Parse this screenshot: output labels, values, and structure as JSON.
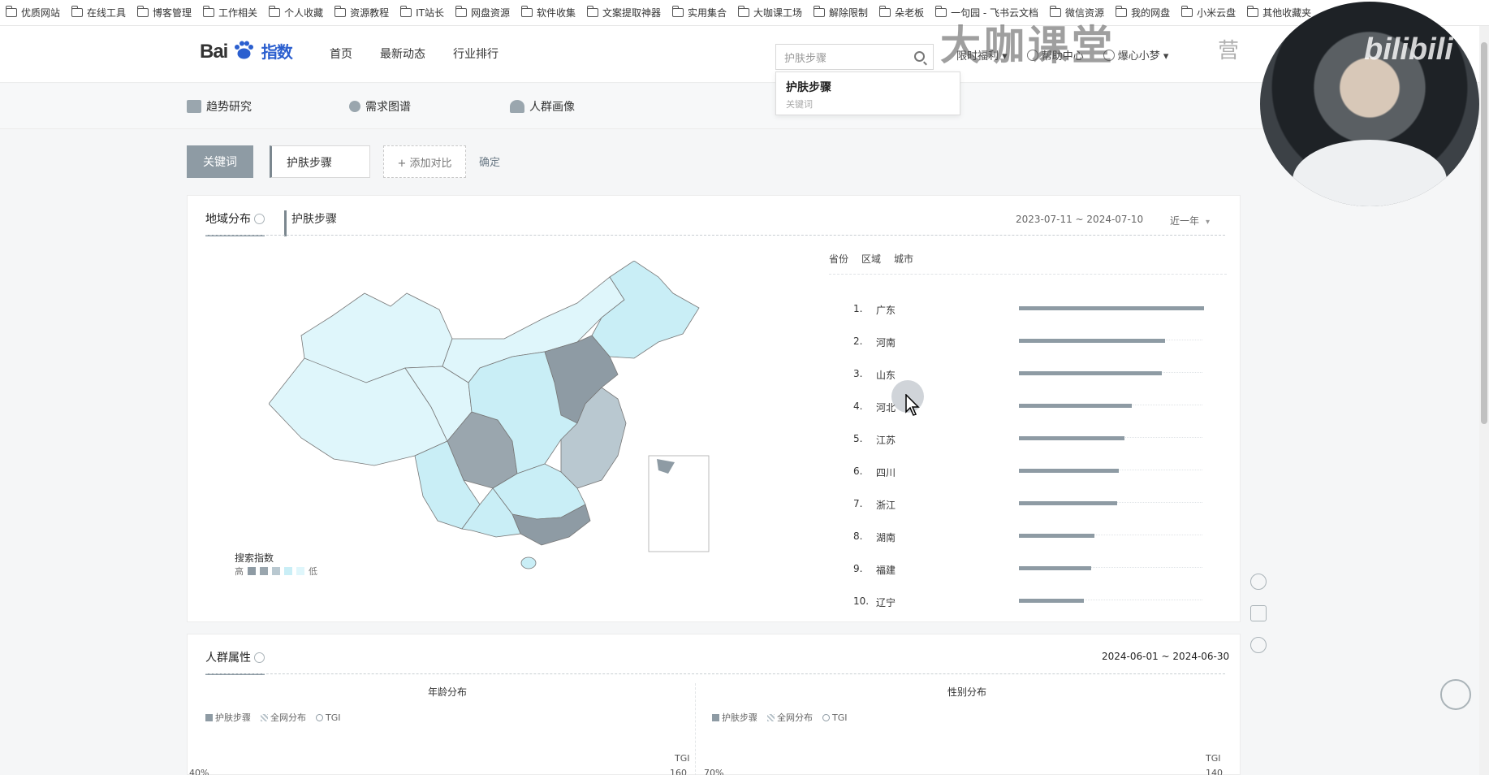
{
  "bookmarks": [
    "优质网站",
    "在线工具",
    "博客管理",
    "工作相关",
    "个人收藏",
    "资源教程",
    "IT站长",
    "网盘资源",
    "软件收集",
    "文案提取神器",
    "实用集合",
    "大咖课工场",
    "解除限制",
    "朵老板",
    "一句园 - 飞书云文档",
    "微信资源",
    "我的网盘",
    "小米云盘",
    "其他收藏夹"
  ],
  "header": {
    "logo_text": "Bai",
    "logo_zh": "指数",
    "nav": [
      "首页",
      "最新动态",
      "行业排行"
    ],
    "search_value": "护肤步骤",
    "right_nav": [
      "限时福利",
      "帮助中心",
      "爆心小梦"
    ]
  },
  "suggest": {
    "keyword": "护肤步骤",
    "type": "关键词"
  },
  "subnav": [
    "趋势研究",
    "需求图谱",
    "人群画像"
  ],
  "keyword_bar": {
    "button": "关键词",
    "keyword": "护肤步骤",
    "add_compare": "+ 添加对比",
    "confirm": "确定"
  },
  "region": {
    "tab": "地域分布",
    "keyword_tag": "护肤步骤",
    "date_range": "2023-07-11 ~ 2024-07-10",
    "period": "近一年",
    "right_tabs": [
      "省份",
      "区域",
      "城市"
    ],
    "legend_title": "搜索指数",
    "legend_high": "高",
    "legend_low": "低",
    "legend_colors": [
      "#8e9ba4",
      "#9aa6ae",
      "#b9c8d0",
      "#c9eef6",
      "#dff6fb"
    ],
    "ranking": [
      {
        "rank": "1.",
        "name": "广东",
        "value": 1.0
      },
      {
        "rank": "2.",
        "name": "河南",
        "value": 0.79
      },
      {
        "rank": "3.",
        "name": "山东",
        "value": 0.77
      },
      {
        "rank": "4.",
        "name": "河北",
        "value": 0.61
      },
      {
        "rank": "5.",
        "name": "江苏",
        "value": 0.57
      },
      {
        "rank": "6.",
        "name": "四川",
        "value": 0.54
      },
      {
        "rank": "7.",
        "name": "浙江",
        "value": 0.53
      },
      {
        "rank": "8.",
        "name": "湖南",
        "value": 0.41
      },
      {
        "rank": "9.",
        "name": "福建",
        "value": 0.39
      },
      {
        "rank": "10.",
        "name": "辽宁",
        "value": 0.35
      }
    ]
  },
  "crowd": {
    "title": "人群属性",
    "date_range": "2024-06-01 ~ 2024-06-30",
    "age_title": "年龄分布",
    "gender_title": "性别分布",
    "legend": [
      "护肤步骤",
      "全网分布",
      "TGI"
    ],
    "tgi_label": "TGI",
    "age_axis_left": "40%",
    "age_axis_right": "160",
    "gender_axis_left": "70%",
    "gender_axis_right": "140"
  },
  "overlay": {
    "watermark": "大咖课堂",
    "watermark2": "营",
    "bili": "bilibili"
  }
}
